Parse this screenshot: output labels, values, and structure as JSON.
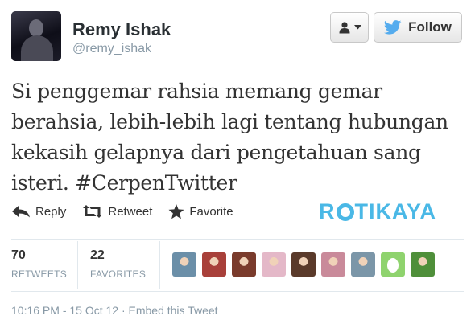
{
  "header": {
    "name": "Remy Ishak",
    "handle": "@remy_ishak",
    "follow_label": "Follow"
  },
  "tweet": {
    "text": "Si penggemar rahsia memang gemar berahsia, lebih-lebih lagi tentang hubungan kekasih gelapnya dari pengetahuan sang isteri. #CerpenTwitter"
  },
  "actions": {
    "reply": "Reply",
    "retweet": "Retweet",
    "favorite": "Favorite"
  },
  "watermark": {
    "before_o": "R",
    "after_o": "TIKAYA"
  },
  "stats": {
    "retweets_count": "70",
    "retweets_label": "RETWEETS",
    "favorites_count": "22",
    "favorites_label": "FAVORITES"
  },
  "favoriters": [
    {
      "icon": "avatar",
      "color": "#6b8fa8"
    },
    {
      "icon": "avatar",
      "color": "#a8403a"
    },
    {
      "icon": "avatar",
      "color": "#7a3b2c"
    },
    {
      "icon": "avatar",
      "color": "#e4b8c8"
    },
    {
      "icon": "avatar",
      "color": "#5a3a2a"
    },
    {
      "icon": "avatar",
      "color": "#c98a9a"
    },
    {
      "icon": "avatar",
      "color": "#7b96a8"
    },
    {
      "icon": "egg-avatar",
      "color": "#8fd36e"
    },
    {
      "icon": "avatar",
      "color": "#4f8f3a"
    }
  ],
  "footer": {
    "timestamp": "10:16 PM - 15 Oct 12 · Embed this Tweet"
  },
  "colors": {
    "accent": "#4ab8e6",
    "muted": "#8899a6",
    "twitter_blue": "#55acee"
  }
}
